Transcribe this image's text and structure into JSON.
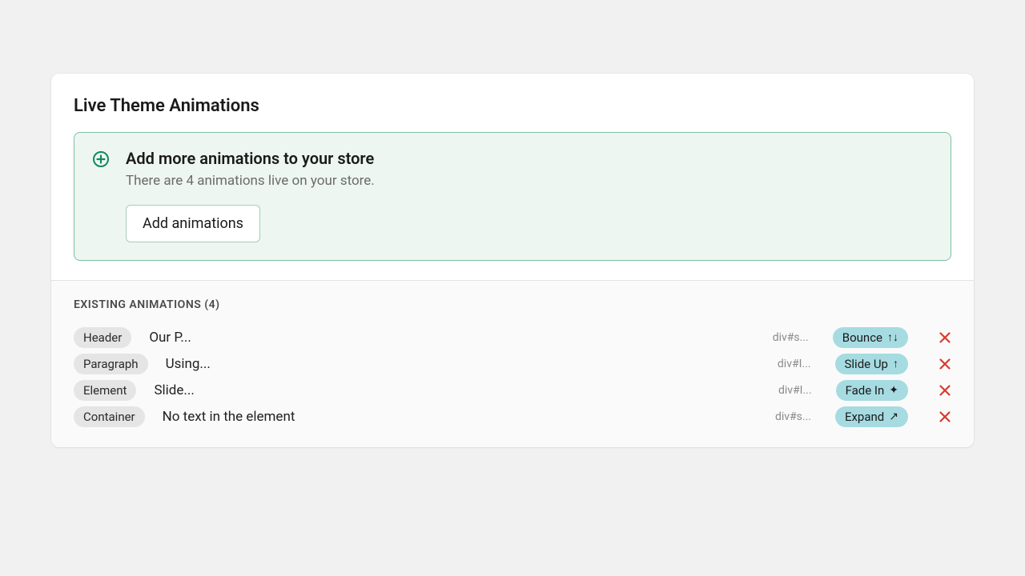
{
  "header": {
    "title": "Live Theme Animations"
  },
  "banner": {
    "title": "Add more animations to your store",
    "subtitle": "There are 4 animations live on your store.",
    "button_label": "Add animations"
  },
  "list": {
    "heading": "EXISTING ANIMATIONS (4)",
    "rows": [
      {
        "type_label": "Header",
        "text": "Our P...",
        "selector": "div#s...",
        "anim_label": "Bounce",
        "anim_glyph": "↑↓",
        "anim_icon_name": "bounce-icon"
      },
      {
        "type_label": "Paragraph",
        "text": "Using...",
        "selector": "div#I...",
        "anim_label": "Slide Up",
        "anim_glyph": "↑",
        "anim_icon_name": "arrow-up-icon"
      },
      {
        "type_label": "Element",
        "text": "Slide...",
        "selector": "div#I...",
        "anim_label": "Fade In",
        "anim_glyph": "✦",
        "anim_icon_name": "sparkle-icon"
      },
      {
        "type_label": "Container",
        "text": "No text in the element",
        "selector": "div#s...",
        "anim_label": "Expand",
        "anim_glyph": "↗",
        "anim_icon_name": "expand-icon"
      }
    ]
  },
  "colors": {
    "accent_bg": "#eef6f2",
    "accent_border": "#7fbfa4",
    "pill_anim_bg": "#a6dbe2",
    "delete": "#d83a2b"
  }
}
